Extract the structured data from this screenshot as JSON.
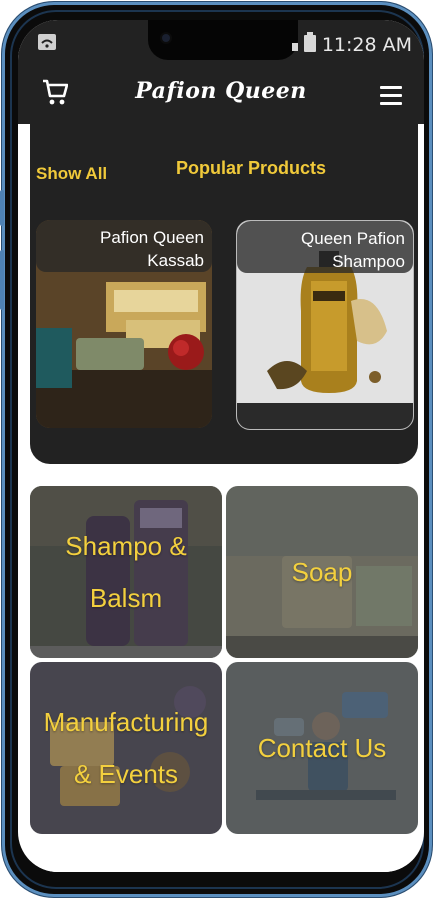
{
  "status_bar": {
    "time": "11:28 AM"
  },
  "app_bar": {
    "brand": "Pafion Queen",
    "cart_icon": "cart-icon",
    "menu_icon": "hamburger-menu-icon"
  },
  "popular": {
    "show_all": "Show All",
    "title": "Popular Products",
    "products": [
      {
        "line1": "Pafion Queen",
        "line2": "Kassab"
      },
      {
        "line1": "Queen Pafion",
        "line2": "Shampoo"
      }
    ]
  },
  "categories": [
    {
      "label": "Shampo & Balsm"
    },
    {
      "label": "Soap"
    },
    {
      "label": "Manufacturing & Events"
    },
    {
      "label": "Contact Us"
    }
  ],
  "colors": {
    "accent_yellow": "#f0c93a",
    "bar_background": "#222222",
    "frame_blue": "#5b8fbf"
  }
}
